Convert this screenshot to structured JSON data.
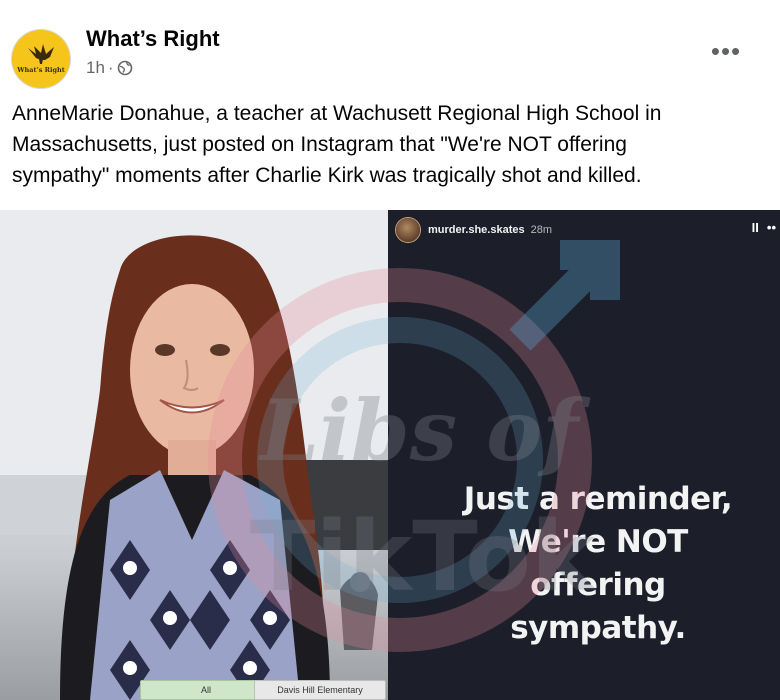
{
  "post": {
    "page_name": "What’s Right",
    "avatar_text": "What’s Right",
    "time": "1h",
    "separator": "·",
    "privacy_icon": "globe-icon",
    "more_icon": "more-options-icon",
    "more_label": "•••",
    "caption_lines": [
      "AnneMarie Donahue, a teacher at Wachusett Regional High School in",
      "Massachusetts, just posted on Instagram that \"We're NOT offering",
      "sympathy\" moments after Charlie Kirk was tragically shot and killed."
    ]
  },
  "story": {
    "username": "murder.she.skates",
    "time": "28m",
    "pause_label": "II",
    "more_label": "••",
    "text_lines": [
      "Just a reminder,",
      "We're NOT",
      "offering",
      "sympathy."
    ]
  },
  "photo": {
    "tab_all": "All",
    "tab_school": "Davis Hill Elementary"
  },
  "watermark": {
    "line1": "Libs of",
    "line2": "TikTok"
  },
  "colors": {
    "avatar_bg": "#f5c51c",
    "text": "#050505",
    "meta": "#65676b",
    "story_bg": "#1c1f2a"
  }
}
